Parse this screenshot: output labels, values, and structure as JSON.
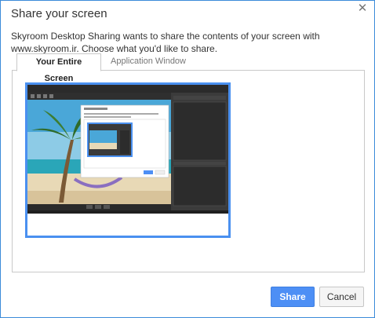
{
  "dialog": {
    "title": "Share your screen",
    "close_icon": "close-icon",
    "description": "Skyroom Desktop Sharing wants to share the contents of your screen with www.skyroom.ir. Choose what you'd like to share."
  },
  "tabs": [
    {
      "label": "Your Entire Screen",
      "active": true
    },
    {
      "label": "Application Window",
      "active": false
    }
  ],
  "thumbnail": {
    "highlight_color": "#4a90f0"
  },
  "buttons": {
    "share": "Share",
    "cancel": "Cancel"
  }
}
